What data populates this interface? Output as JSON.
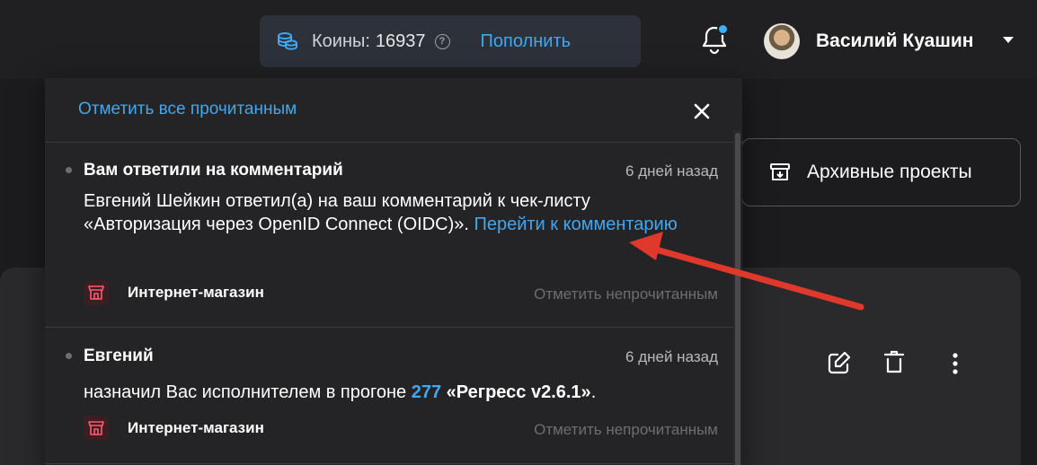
{
  "topbar": {
    "coins_label": "Коины:",
    "coins_value": "16937",
    "help_symbol": "?",
    "topup_label": "Пополнить",
    "user_name": "Василий Куашин"
  },
  "page": {
    "archive_label": "Архивные проекты"
  },
  "notifications": {
    "mark_all_label": "Отметить все прочитанным",
    "items": [
      {
        "title": "Вам ответили на комментарий",
        "time": "6 дней назад",
        "body_text": "Евгений Шейкин ответил(а) на ваш комментарий к чек-листу «Авторизация через OpenID Connect (OIDC)».",
        "body_link": "Перейти к комментарию",
        "project": "Интернет-магазин",
        "mark_unread": "Отметить непрочитанным"
      },
      {
        "title": "Евгений",
        "time": "6 дней назад",
        "body_prefix": "назначил Вас исполнителем в прогоне",
        "run_number": "277",
        "run_name": "«Регресс v2.6.1»",
        "body_suffix": ".",
        "project": "Интернет-магазин",
        "mark_unread": "Отметить непрочитанным"
      }
    ]
  },
  "colors": {
    "accent": "#3fa8f0",
    "background": "#1c1c1e",
    "panel": "#242426",
    "arrow": "#e0392b"
  },
  "icons": [
    "coins-icon",
    "help-icon",
    "bell-icon",
    "avatar",
    "caret-down-icon",
    "archive-icon",
    "close-icon",
    "store-icon",
    "edit-icon",
    "trash-icon",
    "more-vertical-icon"
  ]
}
